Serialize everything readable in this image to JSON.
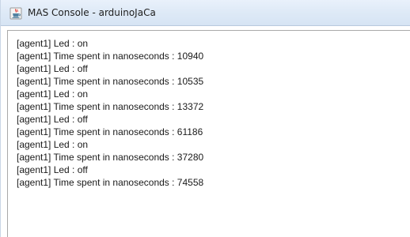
{
  "window": {
    "title": "MAS Console - arduinoJaCa",
    "icon": "java-coffee-cup-icon"
  },
  "console": {
    "lines": [
      "[agent1] Led : on",
      "[agent1] Time spent in nanoseconds : 10940",
      "[agent1] Led : off",
      "[agent1] Time spent in nanoseconds : 10535",
      "[agent1] Led : on",
      "[agent1] Time spent in nanoseconds : 13372",
      "[agent1] Led : off",
      "[agent1] Time spent in nanoseconds : 61186",
      "[agent1] Led : on",
      "[agent1] Time spent in nanoseconds : 37280",
      "[agent1] Led : off",
      "[agent1] Time spent in nanoseconds : 74558"
    ]
  }
}
